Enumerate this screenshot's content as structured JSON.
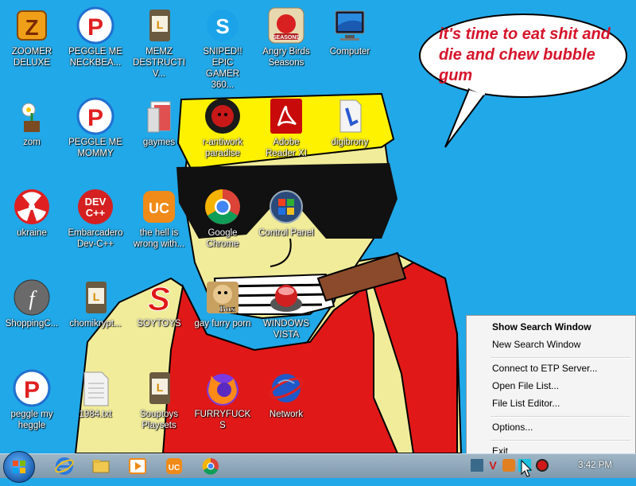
{
  "speech_bubble": {
    "text": "it's time to eat shit and die and chew bubble gum"
  },
  "desktop_icons": [
    {
      "label": "ZOOMER DELUXE",
      "icon": "zoomer-deluxe-icon"
    },
    {
      "label": "PEGGLE ME NECKBEA...",
      "icon": "peggle-icon"
    },
    {
      "label": "MEMZ DESTRUCTIV...",
      "icon": "shortcut-file-icon"
    },
    {
      "label": "SNIPED!! EPIC GAMER 360...",
      "icon": "skype-icon"
    },
    {
      "label": "Angry Birds Seasons",
      "icon": "angry-birds-icon"
    },
    {
      "label": "Computer",
      "icon": "computer-icon"
    },
    {
      "label": "zom",
      "icon": "flower-pot-icon"
    },
    {
      "label": "PEGGLE ME MOMMY",
      "icon": "peggle-icon"
    },
    {
      "label": "gaymes",
      "icon": "folder-icon"
    },
    {
      "label": "r-antiwork paradise",
      "icon": "reddit-icon"
    },
    {
      "label": "Adobe Reader XI",
      "icon": "adobe-reader-icon"
    },
    {
      "label": "digibrony",
      "icon": "shortcut-document-icon"
    },
    {
      "label": "ukraine",
      "icon": "radiation-icon"
    },
    {
      "label": "Embarcadero Dev-C++",
      "icon": "dev-cpp-icon"
    },
    {
      "label": "the hell is wrong with...",
      "icon": "uc-browser-icon"
    },
    {
      "label": "Google Chrome",
      "icon": "chrome-icon"
    },
    {
      "label": "Control Panel",
      "icon": "control-panel-icon"
    },
    {
      "label": "ShoppingC...",
      "icon": "flash-icon"
    },
    {
      "label": "chomikrypt...",
      "icon": "shortcut-file-icon"
    },
    {
      "label": "SOYTOYS",
      "icon": "soytoys-icon"
    },
    {
      "label": "gay furry porn",
      "icon": "hamster-box-icon"
    },
    {
      "label": "WINDOWS VISTA",
      "icon": "vista-orb-icon"
    },
    {
      "label": "peggle my heggle",
      "icon": "peggle-icon"
    },
    {
      "label": "1984.txt",
      "icon": "text-file-icon"
    },
    {
      "label": "Souptoys Playsets",
      "icon": "shortcut-file-icon"
    },
    {
      "label": "FURRYFUCKS",
      "icon": "firefox-icon"
    },
    {
      "label": "Network",
      "icon": "network-icon"
    }
  ],
  "taskbar": {
    "clock": "3:42 PM",
    "pinned": [
      "internet-explorer-icon",
      "file-explorer-icon",
      "media-player-icon",
      "uc-browser-icon",
      "chrome-icon"
    ]
  },
  "context_menu": {
    "items": [
      {
        "label": "Show Search Window",
        "default": true
      },
      {
        "label": "New Search Window"
      },
      {
        "label": "Connect to ETP Server..."
      },
      {
        "label": "Open File List..."
      },
      {
        "label": "File List Editor..."
      },
      {
        "label": "Options..."
      },
      {
        "label": "Exit"
      }
    ]
  }
}
